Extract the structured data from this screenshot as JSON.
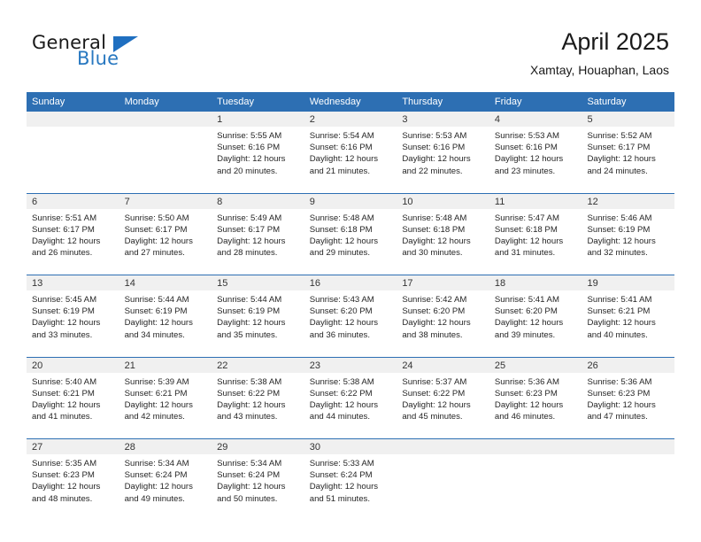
{
  "brand": {
    "line1": "General",
    "line2": "Blue",
    "triangle_color": "#1f6fc0",
    "blue_text_color": "#2878c0"
  },
  "header": {
    "month_title": "April 2025",
    "location": "Xamtay, Houaphan, Laos"
  },
  "theme": {
    "header_blue": "#2d6fb3",
    "row_divider_blue": "#2d6fb3",
    "day_band_gray": "#f0f0f0",
    "page_background": "#ffffff"
  },
  "weekdays": [
    "Sunday",
    "Monday",
    "Tuesday",
    "Wednesday",
    "Thursday",
    "Friday",
    "Saturday"
  ],
  "weeks": [
    [
      {
        "day": "",
        "lines": []
      },
      {
        "day": "",
        "lines": []
      },
      {
        "day": "1",
        "lines": [
          "Sunrise: 5:55 AM",
          "Sunset: 6:16 PM",
          "Daylight: 12 hours",
          "and 20 minutes."
        ]
      },
      {
        "day": "2",
        "lines": [
          "Sunrise: 5:54 AM",
          "Sunset: 6:16 PM",
          "Daylight: 12 hours",
          "and 21 minutes."
        ]
      },
      {
        "day": "3",
        "lines": [
          "Sunrise: 5:53 AM",
          "Sunset: 6:16 PM",
          "Daylight: 12 hours",
          "and 22 minutes."
        ]
      },
      {
        "day": "4",
        "lines": [
          "Sunrise: 5:53 AM",
          "Sunset: 6:16 PM",
          "Daylight: 12 hours",
          "and 23 minutes."
        ]
      },
      {
        "day": "5",
        "lines": [
          "Sunrise: 5:52 AM",
          "Sunset: 6:17 PM",
          "Daylight: 12 hours",
          "and 24 minutes."
        ]
      }
    ],
    [
      {
        "day": "6",
        "lines": [
          "Sunrise: 5:51 AM",
          "Sunset: 6:17 PM",
          "Daylight: 12 hours",
          "and 26 minutes."
        ]
      },
      {
        "day": "7",
        "lines": [
          "Sunrise: 5:50 AM",
          "Sunset: 6:17 PM",
          "Daylight: 12 hours",
          "and 27 minutes."
        ]
      },
      {
        "day": "8",
        "lines": [
          "Sunrise: 5:49 AM",
          "Sunset: 6:17 PM",
          "Daylight: 12 hours",
          "and 28 minutes."
        ]
      },
      {
        "day": "9",
        "lines": [
          "Sunrise: 5:48 AM",
          "Sunset: 6:18 PM",
          "Daylight: 12 hours",
          "and 29 minutes."
        ]
      },
      {
        "day": "10",
        "lines": [
          "Sunrise: 5:48 AM",
          "Sunset: 6:18 PM",
          "Daylight: 12 hours",
          "and 30 minutes."
        ]
      },
      {
        "day": "11",
        "lines": [
          "Sunrise: 5:47 AM",
          "Sunset: 6:18 PM",
          "Daylight: 12 hours",
          "and 31 minutes."
        ]
      },
      {
        "day": "12",
        "lines": [
          "Sunrise: 5:46 AM",
          "Sunset: 6:19 PM",
          "Daylight: 12 hours",
          "and 32 minutes."
        ]
      }
    ],
    [
      {
        "day": "13",
        "lines": [
          "Sunrise: 5:45 AM",
          "Sunset: 6:19 PM",
          "Daylight: 12 hours",
          "and 33 minutes."
        ]
      },
      {
        "day": "14",
        "lines": [
          "Sunrise: 5:44 AM",
          "Sunset: 6:19 PM",
          "Daylight: 12 hours",
          "and 34 minutes."
        ]
      },
      {
        "day": "15",
        "lines": [
          "Sunrise: 5:44 AM",
          "Sunset: 6:19 PM",
          "Daylight: 12 hours",
          "and 35 minutes."
        ]
      },
      {
        "day": "16",
        "lines": [
          "Sunrise: 5:43 AM",
          "Sunset: 6:20 PM",
          "Daylight: 12 hours",
          "and 36 minutes."
        ]
      },
      {
        "day": "17",
        "lines": [
          "Sunrise: 5:42 AM",
          "Sunset: 6:20 PM",
          "Daylight: 12 hours",
          "and 38 minutes."
        ]
      },
      {
        "day": "18",
        "lines": [
          "Sunrise: 5:41 AM",
          "Sunset: 6:20 PM",
          "Daylight: 12 hours",
          "and 39 minutes."
        ]
      },
      {
        "day": "19",
        "lines": [
          "Sunrise: 5:41 AM",
          "Sunset: 6:21 PM",
          "Daylight: 12 hours",
          "and 40 minutes."
        ]
      }
    ],
    [
      {
        "day": "20",
        "lines": [
          "Sunrise: 5:40 AM",
          "Sunset: 6:21 PM",
          "Daylight: 12 hours",
          "and 41 minutes."
        ]
      },
      {
        "day": "21",
        "lines": [
          "Sunrise: 5:39 AM",
          "Sunset: 6:21 PM",
          "Daylight: 12 hours",
          "and 42 minutes."
        ]
      },
      {
        "day": "22",
        "lines": [
          "Sunrise: 5:38 AM",
          "Sunset: 6:22 PM",
          "Daylight: 12 hours",
          "and 43 minutes."
        ]
      },
      {
        "day": "23",
        "lines": [
          "Sunrise: 5:38 AM",
          "Sunset: 6:22 PM",
          "Daylight: 12 hours",
          "and 44 minutes."
        ]
      },
      {
        "day": "24",
        "lines": [
          "Sunrise: 5:37 AM",
          "Sunset: 6:22 PM",
          "Daylight: 12 hours",
          "and 45 minutes."
        ]
      },
      {
        "day": "25",
        "lines": [
          "Sunrise: 5:36 AM",
          "Sunset: 6:23 PM",
          "Daylight: 12 hours",
          "and 46 minutes."
        ]
      },
      {
        "day": "26",
        "lines": [
          "Sunrise: 5:36 AM",
          "Sunset: 6:23 PM",
          "Daylight: 12 hours",
          "and 47 minutes."
        ]
      }
    ],
    [
      {
        "day": "27",
        "lines": [
          "Sunrise: 5:35 AM",
          "Sunset: 6:23 PM",
          "Daylight: 12 hours",
          "and 48 minutes."
        ]
      },
      {
        "day": "28",
        "lines": [
          "Sunrise: 5:34 AM",
          "Sunset: 6:24 PM",
          "Daylight: 12 hours",
          "and 49 minutes."
        ]
      },
      {
        "day": "29",
        "lines": [
          "Sunrise: 5:34 AM",
          "Sunset: 6:24 PM",
          "Daylight: 12 hours",
          "and 50 minutes."
        ]
      },
      {
        "day": "30",
        "lines": [
          "Sunrise: 5:33 AM",
          "Sunset: 6:24 PM",
          "Daylight: 12 hours",
          "and 51 minutes."
        ]
      },
      {
        "day": "",
        "lines": []
      },
      {
        "day": "",
        "lines": []
      },
      {
        "day": "",
        "lines": []
      }
    ]
  ]
}
